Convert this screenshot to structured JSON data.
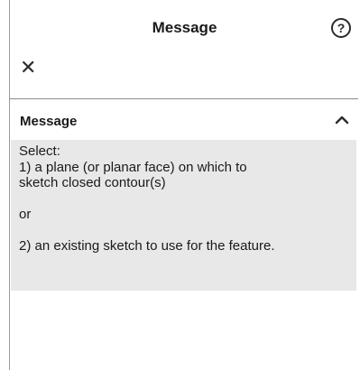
{
  "header": {
    "title": "Message"
  },
  "icons": {
    "help": "?",
    "close": "✕"
  },
  "section": {
    "title": "Message",
    "expanded": true
  },
  "message": {
    "select": "Select:",
    "line1": "1) a plane (or planar face) on which to",
    "line2": "sketch closed contour(s)",
    "or": "or",
    "line3": "2) an existing sketch to use for the feature."
  }
}
